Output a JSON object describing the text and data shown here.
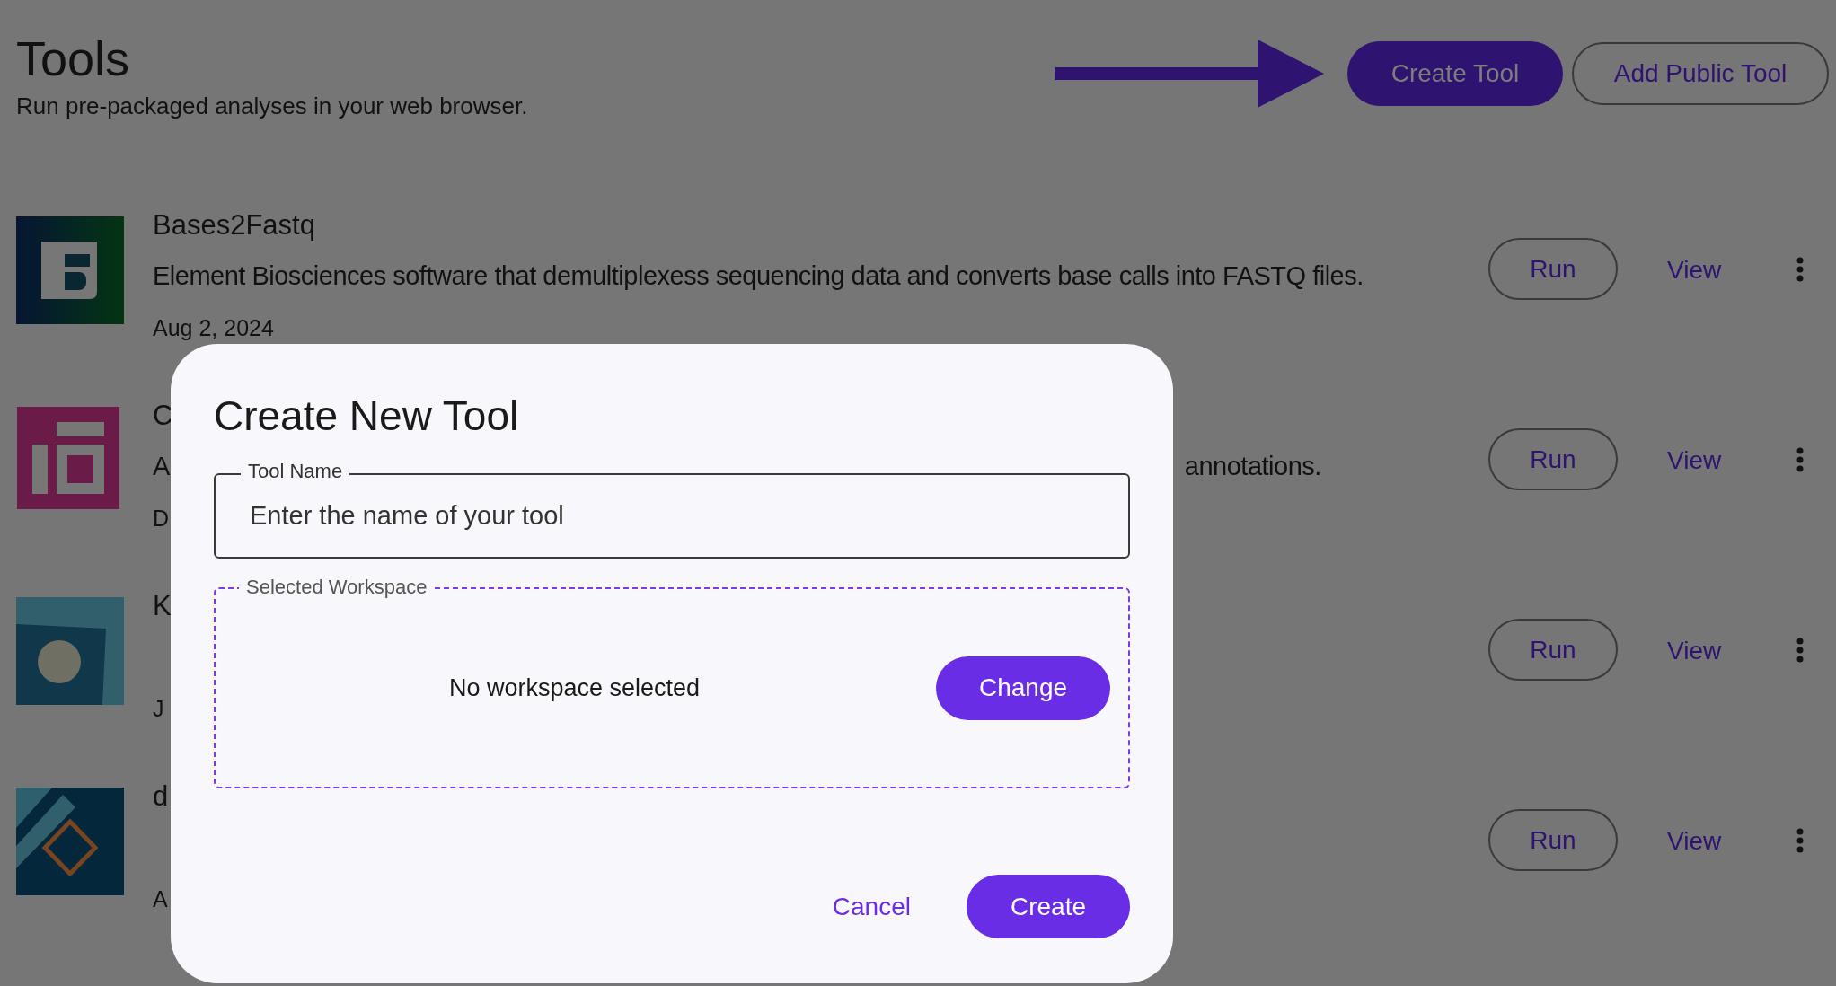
{
  "page": {
    "title": "Tools",
    "subtitle": "Run pre-packaged analyses in your web browser.",
    "create_button": "Create Tool",
    "add_public_button": "Add Public Tool"
  },
  "tools": [
    {
      "kind": "element",
      "title": "Bases2Fastq",
      "description": [
        "Element Biosciences software that demultiplexess sequencing data and converts base calls into FASTQ files."
      ],
      "date": "Aug 2, 2024",
      "run": "Run",
      "view": "View"
    },
    {
      "kind": "grid",
      "title": "C",
      "description": [
        "A",
        "annotations."
      ],
      "date": "D",
      "run": "Run",
      "view": "View"
    },
    {
      "kind": "circle",
      "title": "K",
      "date": "J",
      "run": "Run",
      "view": "View"
    },
    {
      "kind": "diamond",
      "title": "d",
      "date": "A",
      "run": "Run",
      "view": "View"
    }
  ],
  "dialog": {
    "title": "Create New Tool",
    "name_label": "Tool Name",
    "name_placeholder": "Enter the name of your tool",
    "workspace_label": "Selected Workspace",
    "workspace_value": "No workspace selected",
    "change_button": "Change",
    "cancel_button": "Cancel",
    "create_button": "Create"
  }
}
